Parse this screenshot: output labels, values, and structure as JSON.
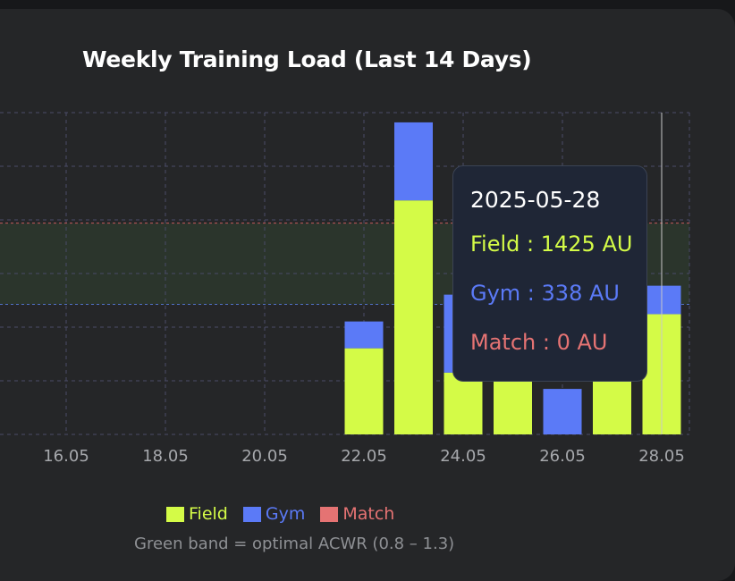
{
  "chart_data": {
    "type": "bar",
    "stacked": true,
    "title": "Weekly Training Load (Last 14 Days)",
    "x": [
      "2025-05-15",
      "2025-05-16",
      "2025-05-17",
      "2025-05-18",
      "2025-05-19",
      "2025-05-20",
      "2025-05-21",
      "2025-05-22",
      "2025-05-23",
      "2025-05-24",
      "2025-05-25",
      "2025-05-26",
      "2025-05-27",
      "2025-05-28"
    ],
    "tick_labels": [
      "16.05",
      "18.05",
      "20.05",
      "22.05",
      "24.05",
      "26.05",
      "28.05"
    ],
    "series": [
      {
        "name": "Field",
        "color": "#d4fb47",
        "values": [
          0,
          0,
          0,
          0,
          0,
          0,
          0,
          530,
          1440,
          380,
          360,
          0,
          360,
          740
        ]
      },
      {
        "name": "Gym",
        "color": "#5b7af7",
        "values": [
          0,
          0,
          0,
          0,
          0,
          0,
          0,
          165,
          480,
          480,
          400,
          280,
          430,
          175
        ]
      },
      {
        "name": "Match",
        "color": "#e57373",
        "values": [
          0,
          0,
          0,
          0,
          0,
          0,
          0,
          0,
          0,
          0,
          0,
          0,
          0,
          0
        ]
      }
    ],
    "ylim": [
      0,
      1980
    ],
    "optimal_band": [
      800,
      1300
    ],
    "band_upper_line": 1300,
    "band_lower_line": 800,
    "grid": true,
    "legend_placement": "bottom",
    "hover_crosshair_date": "2025-05-28"
  },
  "tooltip": {
    "date": "2025-05-28",
    "field": "Field : 1425 AU",
    "gym": "Gym : 338 AU",
    "match": "Match : 0 AU"
  },
  "legend": [
    "Field",
    "Gym",
    "Match"
  ],
  "note": "Green band = optimal ACWR (0.8 – 1.3)",
  "colors": {
    "field": "#d4fb47",
    "gym": "#5b7af7",
    "match": "#e57373",
    "band": "#2b352c",
    "grid": "#4a4c68"
  }
}
